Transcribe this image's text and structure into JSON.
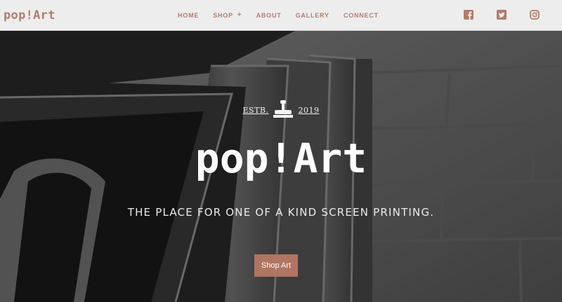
{
  "header": {
    "logo": "pop!Art",
    "nav": [
      {
        "label": "HOME"
      },
      {
        "label": "SHOP",
        "caret": "+"
      },
      {
        "label": "ABOUT"
      },
      {
        "label": "GALLERY"
      },
      {
        "label": "CONNECT"
      }
    ],
    "socials": [
      "facebook-icon",
      "twitter-icon",
      "instagram-icon"
    ]
  },
  "hero": {
    "estb_left": "ESTB.",
    "estb_year": "2019",
    "title": "pop!Art",
    "tagline": "THE PLACE FOR ONE OF A KIND SCREEN PRINTING.",
    "cta_label": "Shop Art"
  },
  "colors": {
    "accent": "#b07d6c",
    "cta_bg": "#b07563",
    "header_bg": "#ededee"
  }
}
